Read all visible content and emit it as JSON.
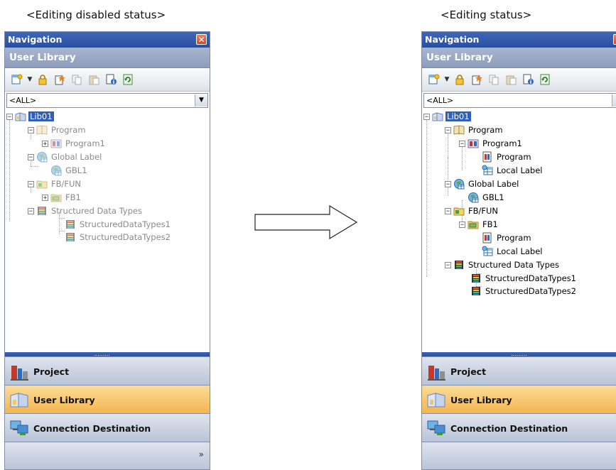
{
  "captions": {
    "left": "<Editing disabled status>",
    "right": "<Editing status>"
  },
  "panel": {
    "title": "Navigation",
    "close_icon": "close-icon",
    "section_title": "User Library",
    "filter_value": "<ALL>"
  },
  "toolbar_icons": [
    "new-item-icon",
    "lock-icon",
    "add-new-data-icon",
    "copy-icon",
    "paste-icon",
    "properties-icon",
    "refresh-icon"
  ],
  "left_tree": {
    "root": "Lib01",
    "program": "Program",
    "program1": "Program1",
    "global_label": "Global Label",
    "gbl1": "GBL1",
    "fbfun": "FB/FUN",
    "fb1": "FB1",
    "structured": "Structured Data Types",
    "sdt1": "StructuredDataTypes1",
    "sdt2": "StructuredDataTypes2"
  },
  "right_tree": {
    "root": "Lib01",
    "program": "Program",
    "program1": "Program1",
    "program1_program": "Program",
    "program1_local": "Local Label",
    "global_label": "Global Label",
    "gbl1": "GBL1",
    "fbfun": "FB/FUN",
    "fb1": "FB1",
    "fb1_program": "Program",
    "fb1_local": "Local Label",
    "structured": "Structured Data Types",
    "sdt1": "StructuredDataTypes1",
    "sdt2": "StructuredDataTypes2"
  },
  "nav": {
    "project": "Project",
    "user_library": "User Library",
    "connection": "Connection Destination",
    "more_icon": "chevron-double-down-icon",
    "splitter": "........."
  },
  "colors": {
    "title_bar": "#2a4f9e",
    "selected": "#2f5fb8",
    "active_tab": "#f4b54f"
  }
}
